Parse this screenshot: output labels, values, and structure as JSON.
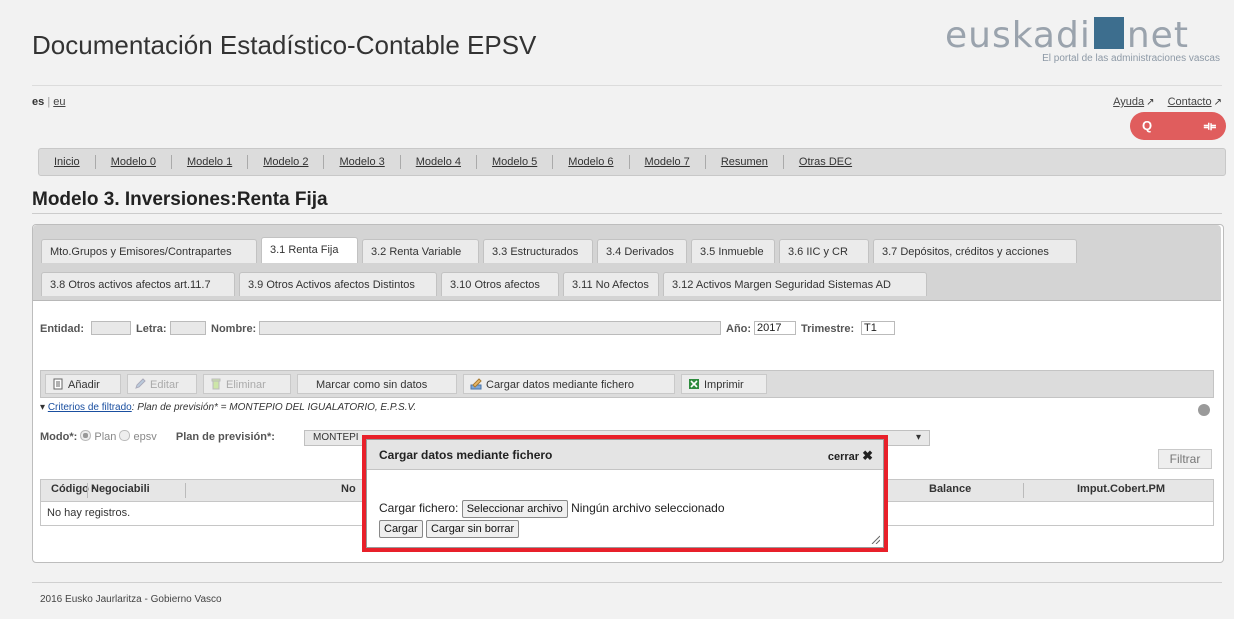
{
  "header": {
    "title": "Documentación Estadístico-Contable EPSV",
    "logo_word_left": "euskadi",
    "logo_word_right": "net",
    "logo_tagline": "El portal de las administraciones vascas"
  },
  "topbar": {
    "lang_es": "es",
    "lang_sep": "|",
    "lang_eu": "eu",
    "help": "Ayuda",
    "contact": "Contacto",
    "pill_left": "Q",
    "pill_right": "⟚"
  },
  "nav": [
    "Inicio",
    "Modelo 0",
    "Modelo 1",
    "Modelo 2",
    "Modelo 3",
    "Modelo 4",
    "Modelo 5",
    "Modelo 6",
    "Modelo 7",
    "Resumen",
    "Otras DEC"
  ],
  "section_title": "Modelo 3. Inversiones:Renta Fija",
  "tabs_row1": [
    "Mto.Grupos y Emisores/Contrapartes",
    "3.1 Renta Fija",
    "3.2 Renta Variable",
    "3.3 Estructurados",
    "3.4 Derivados",
    "3.5 Inmueble",
    "3.6 IIC y CR",
    "3.7 Depósitos, créditos y acciones"
  ],
  "tabs_row2": [
    "3.8 Otros activos afectos art.11.7",
    "3.9 Otros Activos afectos Distintos",
    "3.10 Otros afectos",
    "3.11 No Afectos",
    "3.12 Activos Margen Seguridad Sistemas AD"
  ],
  "filters": {
    "entidad_label": "Entidad:",
    "letra_label": "Letra:",
    "nombre_label": "Nombre:",
    "anio_label": "Año:",
    "anio_value": "2017",
    "trimestre_label": "Trimestre:",
    "trimestre_value": "T1"
  },
  "toolbar": {
    "add": "Añadir",
    "edit": "Editar",
    "delete": "Eliminar",
    "mark_no_data": "Marcar como sin datos",
    "load_file": "Cargar datos mediante fichero",
    "print": "Imprimir"
  },
  "criteria": {
    "link": "Criterios de filtrado",
    "text": ": Plan de previsión* = MONTEPIO DEL IGUALATORIO, E.P.S.V."
  },
  "modo": {
    "label": "Modo*:",
    "opt_plan": "Plan",
    "opt_epsv": "epsv",
    "plan_label": "Plan de previsión*:",
    "plan_value": "MONTEPI"
  },
  "filtrar": "Filtrar",
  "table": {
    "headers": [
      "Código ·",
      "Negociabili",
      "No",
      "Balance",
      "Imput.Cobert.PM"
    ],
    "empty": "No hay registros."
  },
  "modal": {
    "title": "Cargar datos mediante fichero",
    "close": "cerrar",
    "file_label": "Cargar fichero:",
    "choose_button": "Seleccionar archivo",
    "no_file": "Ningún archivo seleccionado",
    "load": "Cargar",
    "load_no_delete": "Cargar sin borrar"
  },
  "footer": "2016 Eusko Jaurlaritza - Gobierno Vasco"
}
